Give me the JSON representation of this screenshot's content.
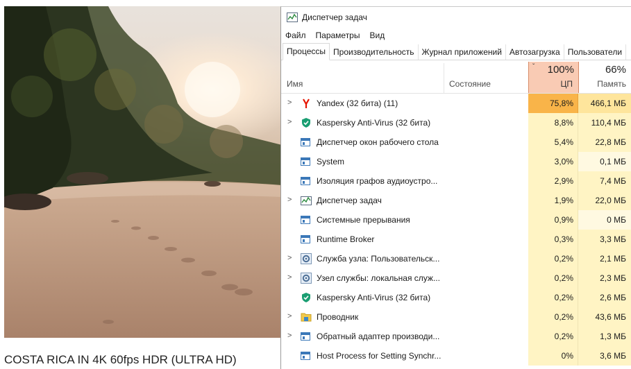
{
  "video": {
    "caption": "COSTA RICA IN 4K 60fps HDR (ULTRA HD)"
  },
  "window": {
    "title": "Диспетчер задач",
    "menu": [
      "Файл",
      "Параметры",
      "Вид"
    ],
    "tabs": [
      "Процессы",
      "Производительность",
      "Журнал приложений",
      "Автозагрузка",
      "Пользователи"
    ],
    "active_tab": "Процессы"
  },
  "columns": {
    "name": "Имя",
    "status": "Состояние",
    "cpu_total": "100%",
    "cpu_label": "ЦП",
    "mem_total": "66%",
    "mem_label": "Память",
    "sort_indicator": "ˇ"
  },
  "processes": [
    {
      "name": "Yandex (32 бита) (11)",
      "cpu": "75,8%",
      "mem": "466,1 МБ",
      "expandable": true,
      "icon": "yandex-icon"
    },
    {
      "name": "Kaspersky Anti-Virus (32 бита)",
      "cpu": "8,8%",
      "mem": "110,4 МБ",
      "expandable": true,
      "icon": "kaspersky-shield-icon"
    },
    {
      "name": "Диспетчер окон рабочего стола",
      "cpu": "5,4%",
      "mem": "22,8 МБ",
      "expandable": false,
      "icon": "window-icon"
    },
    {
      "name": "System",
      "cpu": "3,0%",
      "mem": "0,1 МБ",
      "expandable": false,
      "icon": "window-icon"
    },
    {
      "name": "Изоляция графов аудиоустро...",
      "cpu": "2,9%",
      "mem": "7,4 МБ",
      "expandable": false,
      "icon": "window-icon"
    },
    {
      "name": "Диспетчер задач",
      "cpu": "1,9%",
      "mem": "22,0 МБ",
      "expandable": true,
      "icon": "task-manager-icon"
    },
    {
      "name": "Системные прерывания",
      "cpu": "0,9%",
      "mem": "0 МБ",
      "expandable": false,
      "icon": "window-icon"
    },
    {
      "name": "Runtime Broker",
      "cpu": "0,3%",
      "mem": "3,3 МБ",
      "expandable": false,
      "icon": "window-icon"
    },
    {
      "name": "Служба узла: Пользовательск...",
      "cpu": "0,2%",
      "mem": "2,1 МБ",
      "expandable": true,
      "icon": "gear-icon"
    },
    {
      "name": "Узел службы: локальная служ...",
      "cpu": "0,2%",
      "mem": "2,3 МБ",
      "expandable": true,
      "icon": "gear-icon"
    },
    {
      "name": "Kaspersky Anti-Virus (32 бита)",
      "cpu": "0,2%",
      "mem": "2,6 МБ",
      "expandable": false,
      "icon": "kaspersky-shield-icon"
    },
    {
      "name": "Проводник",
      "cpu": "0,2%",
      "mem": "43,6 МБ",
      "expandable": true,
      "icon": "folder-icon"
    },
    {
      "name": "Обратный адаптер производи...",
      "cpu": "0,2%",
      "mem": "1,3 МБ",
      "expandable": true,
      "icon": "window-icon"
    },
    {
      "name": "Host Process for Setting Synchr...",
      "cpu": "0%",
      "mem": "3,6 МБ",
      "expandable": false,
      "icon": "window-icon"
    }
  ]
}
